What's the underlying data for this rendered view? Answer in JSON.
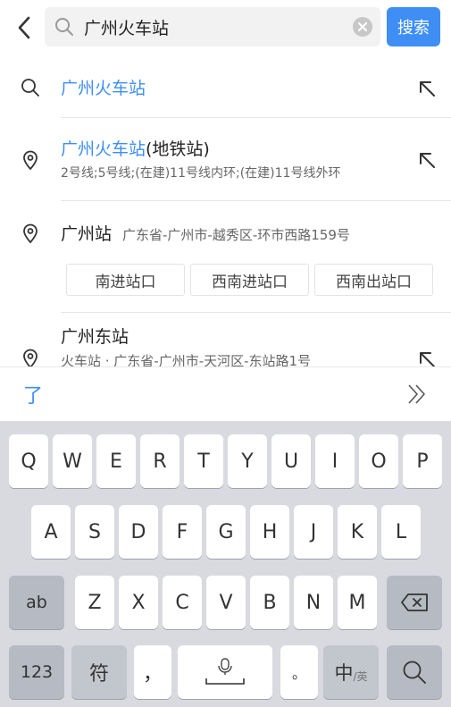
{
  "search": {
    "query": "广州火车站",
    "button_label": "搜索"
  },
  "suggestions": [
    {
      "type": "query",
      "highlight": "广州火车站",
      "rest": ""
    },
    {
      "type": "place",
      "highlight": "广州火车站",
      "rest": "(地铁站)",
      "subtitle": "2号线;5号线;(在建)11号线内环;(在建)11号线外环"
    },
    {
      "type": "place",
      "name": "广州站",
      "address": "广东省-广州市-越秀区-环市西路159号",
      "entrances": [
        "南进站口",
        "西南进站口",
        "西南出站口"
      ]
    },
    {
      "type": "place",
      "name": "广州东站",
      "subtitle": "火车站 · 广东省-广州市-天河区-东站路1号"
    }
  ],
  "candidate_bar": {
    "candidate": "了",
    "expand_icon": "double-chevron-right-icon"
  },
  "keyboard": {
    "row1": [
      "Q",
      "W",
      "E",
      "R",
      "T",
      "Y",
      "U",
      "I",
      "O",
      "P"
    ],
    "row2": [
      "A",
      "S",
      "D",
      "F",
      "G",
      "H",
      "J",
      "K",
      "L"
    ],
    "row3_left": "ab",
    "row3": [
      "Z",
      "X",
      "C",
      "V",
      "B",
      "N",
      "M"
    ],
    "row4_numbers": "123",
    "row4_symbols": "符",
    "row4_comma": "，",
    "row4_period": "。",
    "row4_lang_main": "中",
    "row4_lang_sub": "/英"
  },
  "colors": {
    "accent": "#3e8ef6",
    "keyboard_bg": "#d8dadf"
  }
}
